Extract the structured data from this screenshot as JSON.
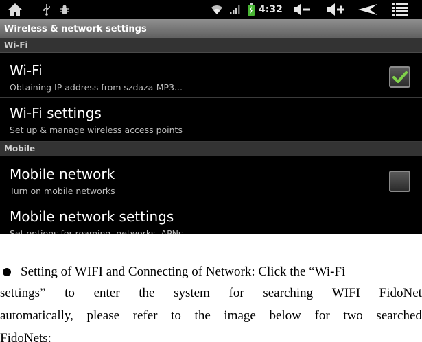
{
  "status_bar": {
    "time": "4:32",
    "icons": [
      "home-icon",
      "usb-icon",
      "debug-icon",
      "wifi-icon",
      "signal-icon",
      "battery-icon",
      "volume-down-icon",
      "volume-up-icon",
      "back-icon",
      "menu-icon"
    ]
  },
  "screen": {
    "title": "Wireless & network settings",
    "sections": [
      {
        "header": "Wi-Fi",
        "items": [
          {
            "title": "Wi-Fi",
            "subtitle": "Obtaining IP address from szdaza-MP3...",
            "checked": true
          },
          {
            "title": "Wi-Fi settings",
            "subtitle": "Set up & manage wireless access points"
          }
        ]
      },
      {
        "header": "Mobile",
        "items": [
          {
            "title": "Mobile network",
            "subtitle": "Turn on mobile networks",
            "checked": false
          },
          {
            "title": "Mobile network settings",
            "subtitle": "Set options for roaming, networks, APNs"
          }
        ]
      }
    ],
    "colors": {
      "check_accent": "#7fd14a",
      "title_bar": "#7a7a7a",
      "section_header": "#333333"
    }
  },
  "document": {
    "line1_text": "Setting of WIFI and Connecting of Network: Click the “Wi-Fi",
    "line2_words": [
      "settings”",
      "to",
      "enter",
      "the",
      "system",
      "for",
      "searching",
      "WIFI",
      "FidoNet"
    ],
    "line3_words": [
      "automatically,",
      "please",
      "refer",
      "to",
      "the",
      "image",
      "below",
      "for",
      "two",
      "searched"
    ],
    "line4_text": "FidoNets:"
  }
}
